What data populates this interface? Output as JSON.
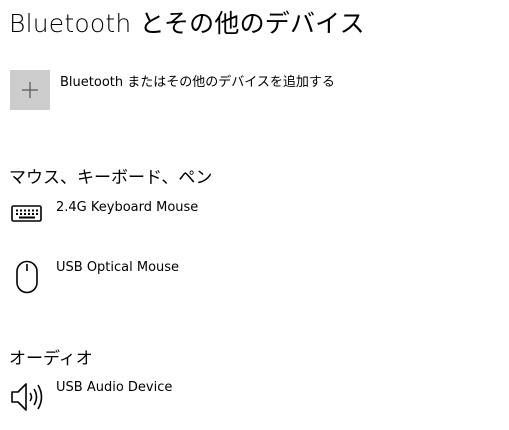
{
  "page": {
    "title": "Bluetooth とその他のデバイス"
  },
  "add_device": {
    "label": "Bluetooth またはその他のデバイスを追加する",
    "icon": "plus-icon"
  },
  "sections": {
    "input": {
      "heading": "マウス、キーボード、ペン",
      "devices": [
        {
          "name": "2.4G Keyboard Mouse",
          "icon": "keyboard-icon"
        },
        {
          "name": "USB Optical Mouse",
          "icon": "mouse-icon"
        }
      ]
    },
    "audio": {
      "heading": "オーディオ",
      "devices": [
        {
          "name": "USB Audio Device",
          "icon": "speaker-icon"
        }
      ]
    }
  }
}
